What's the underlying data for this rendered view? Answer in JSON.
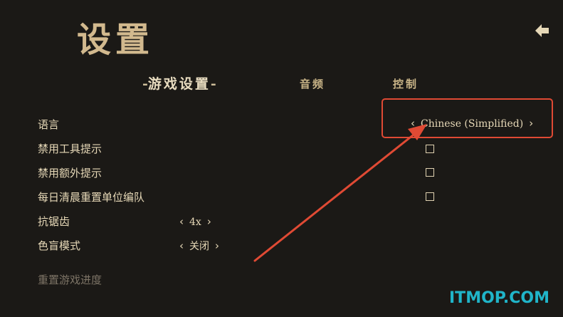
{
  "header": {
    "title": "设置"
  },
  "tabs": {
    "active_dash_left": "-",
    "active": "游戏设置",
    "active_dash_right": "-",
    "audio": "音频",
    "control": "控制"
  },
  "settings": {
    "language": {
      "label": "语言",
      "value": "Chinese (Simplified)"
    },
    "disable_tool_tips": {
      "label": "禁用工具提示"
    },
    "disable_extra_tips": {
      "label": "禁用额外提示"
    },
    "daily_reset_units": {
      "label": "每日清晨重置单位编队"
    },
    "antialiasing": {
      "label": "抗锯齿",
      "value": "4x"
    },
    "colorblind_mode": {
      "label": "色盲模式",
      "value": "关闭"
    },
    "reset_progress": {
      "label": "重置游戏进度"
    }
  },
  "watermark": "ITMOP.COM",
  "colors": {
    "background": "#1b1916",
    "title": "#d2b98e",
    "annotation": "#e04a34",
    "watermark": "#20b5c9"
  }
}
